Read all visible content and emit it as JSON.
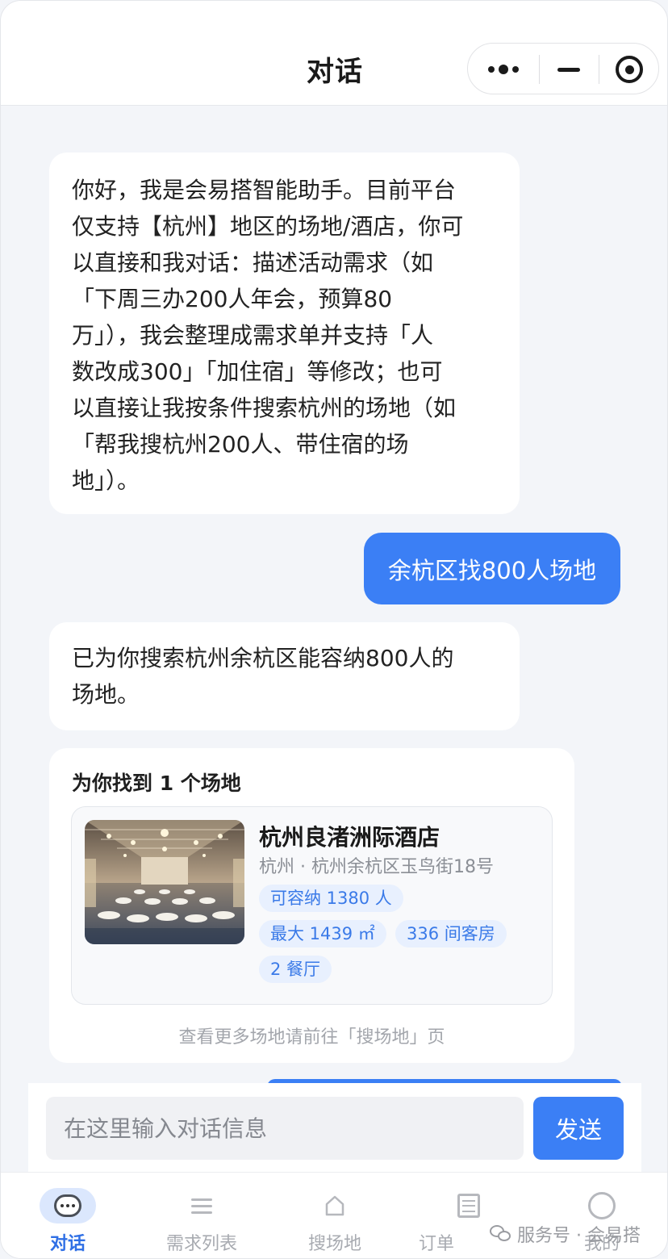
{
  "header": {
    "title": "对话"
  },
  "messages": {
    "bot_greeting_lines": [
      "你好，我是会易搭智能助手。目前平台",
      "仅支持【杭州】地区的场地/酒店，你可",
      "以直接和我对话：描述活动需求（如",
      "「下周三办200人年会，预算80",
      "万」），我会整理成需求单并支持「人",
      "数改成300」「加住宿」等修改；也可",
      "以直接让我按条件搜索杭州的场地（如",
      "「帮我搜杭州200人、带住宿的场",
      "地」）。"
    ],
    "user_query": "余杭区找800人场地",
    "bot_reply_lines": [
      "已为你搜索杭州余杭区能容纳800人的",
      "场地。"
    ]
  },
  "result_card": {
    "title": "为你找到 1 个场地",
    "venue": {
      "name": "杭州良渚洲际酒店",
      "address": "杭州 · 杭州余杭区玉鸟街18号",
      "capacity": "可容纳 1380 人",
      "area": "最大 1439 ㎡",
      "rooms": "336 间客房",
      "restaurants": "2 餐厅"
    },
    "footer": "查看更多场地请前往「搜场地」页"
  },
  "input": {
    "placeholder": "在这里输入对话信息",
    "send_label": "发送"
  },
  "tabbar": {
    "items": [
      {
        "label": "对话",
        "icon": "chat-bubble-icon",
        "active": true
      },
      {
        "label": "需求列表",
        "icon": "list-icon"
      },
      {
        "label": "搜场地",
        "icon": "home-icon"
      },
      {
        "label": "订单",
        "icon": "document-icon"
      },
      {
        "label": "我的",
        "icon": "profile-icon"
      }
    ]
  },
  "watermark": {
    "text": "服务号 · 会易搭"
  },
  "colors": {
    "accent": "#3b7ff5",
    "tag_bg": "#e8f0fe",
    "tag_text": "#3a7ae8",
    "page_bg": "#f3f5f9"
  }
}
